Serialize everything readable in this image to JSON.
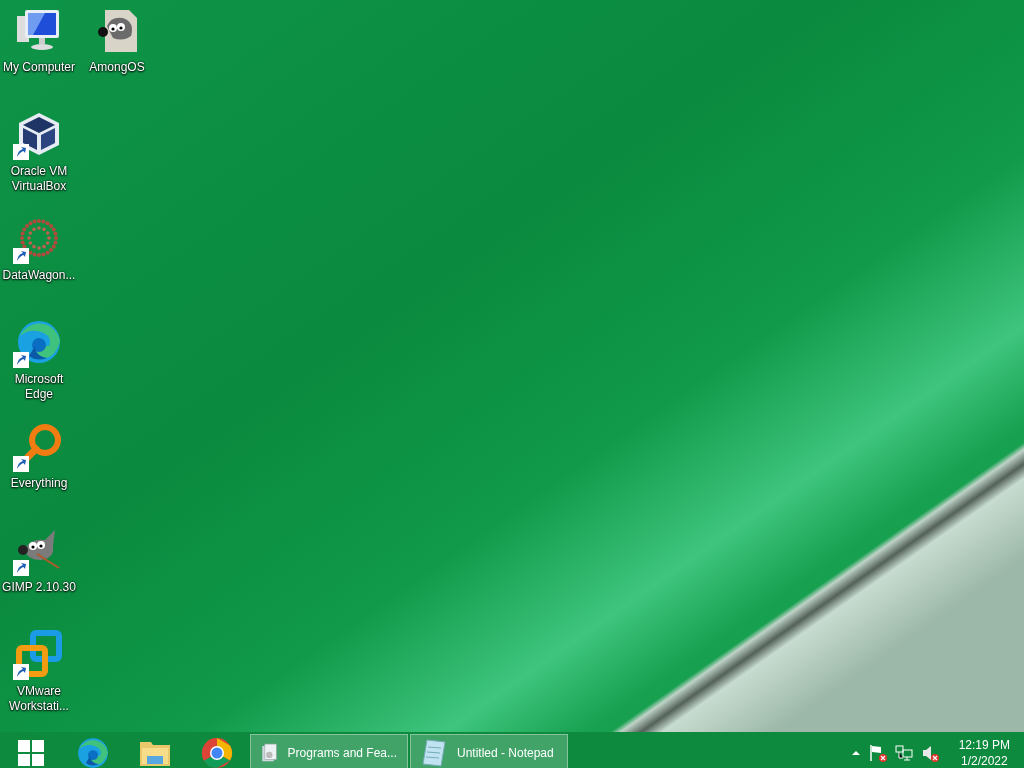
{
  "desktop_icons": [
    {
      "label": "My Computer",
      "kind": "computer",
      "shortcut": false
    },
    {
      "label": "Oracle VM VirtualBox",
      "kind": "cube",
      "shortcut": true
    },
    {
      "label": "DataWagon...",
      "kind": "dots",
      "shortcut": true
    },
    {
      "label": "Microsoft Edge",
      "kind": "edge",
      "shortcut": true
    },
    {
      "label": "Everything",
      "kind": "magnifier",
      "shortcut": true
    },
    {
      "label": "GIMP 2.10.30",
      "kind": "gimp",
      "shortcut": true
    },
    {
      "label": "VMware Workstati...",
      "kind": "vmware",
      "shortcut": true
    },
    {
      "label": "AmongOS",
      "kind": "gimp-doc",
      "shortcut": false
    }
  ],
  "taskbar": {
    "pinned": [
      {
        "kind": "start"
      },
      {
        "kind": "edge"
      },
      {
        "kind": "folder"
      },
      {
        "kind": "chrome"
      }
    ],
    "windows": [
      {
        "title": "Programs and Fea...",
        "kind": "programs"
      },
      {
        "title": "Untitled - Notepad",
        "kind": "notepad"
      }
    ],
    "tray": [
      {
        "kind": "flag"
      },
      {
        "kind": "network"
      },
      {
        "kind": "speaker"
      }
    ],
    "clock": {
      "time": "12:19 PM",
      "date": "1/2/2022"
    }
  }
}
